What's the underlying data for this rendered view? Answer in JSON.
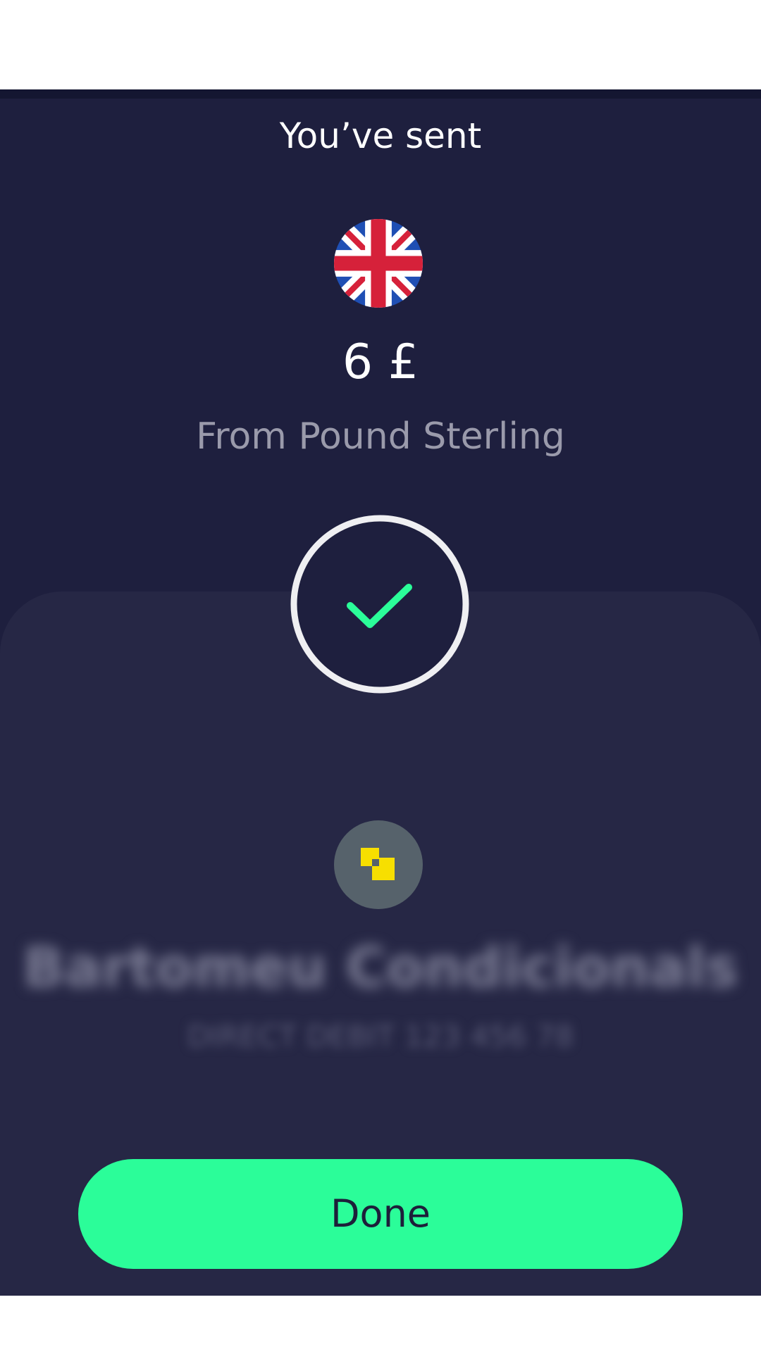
{
  "header": {
    "title": "You’ve sent"
  },
  "transfer": {
    "currency_flag_icon": "uk-flag-icon",
    "amount": "6 £",
    "source": "From Pound Sterling"
  },
  "status": {
    "icon": "check-icon",
    "ring_color": "#efeff2",
    "check_color": "#2bfd99"
  },
  "recipient": {
    "avatar_icon": "overlapping-squares-icon",
    "name": "Bartomeu Condicionals",
    "detail": "DIRECT DEBIT 123 456 78"
  },
  "actions": {
    "done_label": "Done"
  },
  "colors": {
    "background": "#1e1f3e",
    "sheet": "#262745",
    "accent": "#2bfd99"
  }
}
